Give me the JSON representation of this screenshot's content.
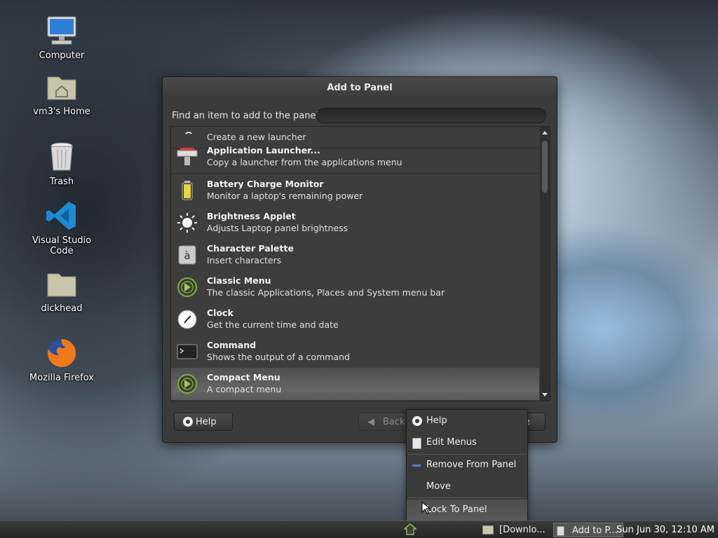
{
  "desktop": {
    "icons": [
      {
        "label": "Computer",
        "icon": "computer-icon"
      },
      {
        "label": "vm3's Home",
        "icon": "home-folder-icon"
      },
      {
        "label": "Trash",
        "icon": "trash-icon"
      },
      {
        "label": "Visual Studio Code",
        "icon": "vscode-icon"
      },
      {
        "label": "dickhead",
        "icon": "folder-icon"
      },
      {
        "label": "Mozilla Firefox",
        "icon": "firefox-icon"
      }
    ]
  },
  "dialog": {
    "title": "Add to Panel",
    "find_label": "Find an item to add to the panel:",
    "search_value": "",
    "items": [
      {
        "name": "",
        "desc": "Create a new launcher",
        "icon": "launcher-icon"
      },
      {
        "name": "Application Launcher...",
        "desc": "Copy a launcher from the applications menu",
        "icon": "app-launcher-icon"
      },
      {
        "name": "Battery Charge Monitor",
        "desc": "Monitor a laptop's remaining power",
        "icon": "battery-icon"
      },
      {
        "name": "Brightness Applet",
        "desc": "Adjusts Laptop panel brightness",
        "icon": "brightness-icon"
      },
      {
        "name": "Character Palette",
        "desc": "Insert characters",
        "icon": "character-palette-icon"
      },
      {
        "name": "Classic Menu",
        "desc": "The classic Applications, Places and System menu bar",
        "icon": "classic-menu-icon"
      },
      {
        "name": "Clock",
        "desc": "Get the current time and date",
        "icon": "clock-icon"
      },
      {
        "name": "Command",
        "desc": "Shows the output of a command",
        "icon": "terminal-icon"
      },
      {
        "name": "Compact Menu",
        "desc": "A compact menu",
        "icon": "compact-menu-icon"
      }
    ],
    "buttons": {
      "help": "Help",
      "back": "Back",
      "close": "se"
    }
  },
  "context_menu": {
    "items": [
      {
        "label": "Help",
        "icon": "help-icon"
      },
      {
        "label": "Edit Menus",
        "icon": "edit-menus-icon"
      },
      {
        "label": "Remove From Panel",
        "icon": "remove-icon"
      },
      {
        "label": "Move",
        "icon": ""
      },
      {
        "label": "Lock To Panel",
        "icon": ""
      }
    ]
  },
  "taskbar": {
    "tasks": [
      {
        "label": "[Downlo...",
        "icon": "folder-icon"
      },
      {
        "label": "Add to P...",
        "icon": "window-icon"
      }
    ],
    "clock": "Sun Jun 30, 12:10 AM"
  }
}
